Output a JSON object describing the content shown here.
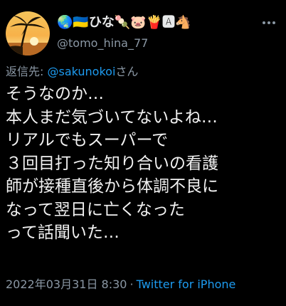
{
  "author": {
    "display_name": "🌏🇺🇦ひな🍡🐷🍟🅰🐴",
    "handle": "@tomo_hina_77",
    "avatar": "tropical-sunset-palm-avatar"
  },
  "reply": {
    "prefix": "返信先: ",
    "target": "@sakunokoi",
    "suffix": "さん"
  },
  "tweet": {
    "lines": [
      "そうなのか…",
      "本人まだ気づいてないよね…",
      "リアルでもスーパーで",
      "３回目打った知り合いの看護",
      "師が接種直後から体調不良に",
      "なって翌日に亡くなった",
      "って話聞いた…"
    ]
  },
  "meta": {
    "timestamp": "2022年03月31日 8:30",
    "separator": "·",
    "source": "Twitter for iPhone"
  },
  "colors": {
    "background": "#000000",
    "text": "#e7e9ea",
    "secondary": "#8b98a5",
    "link": "#1d9bf0"
  }
}
